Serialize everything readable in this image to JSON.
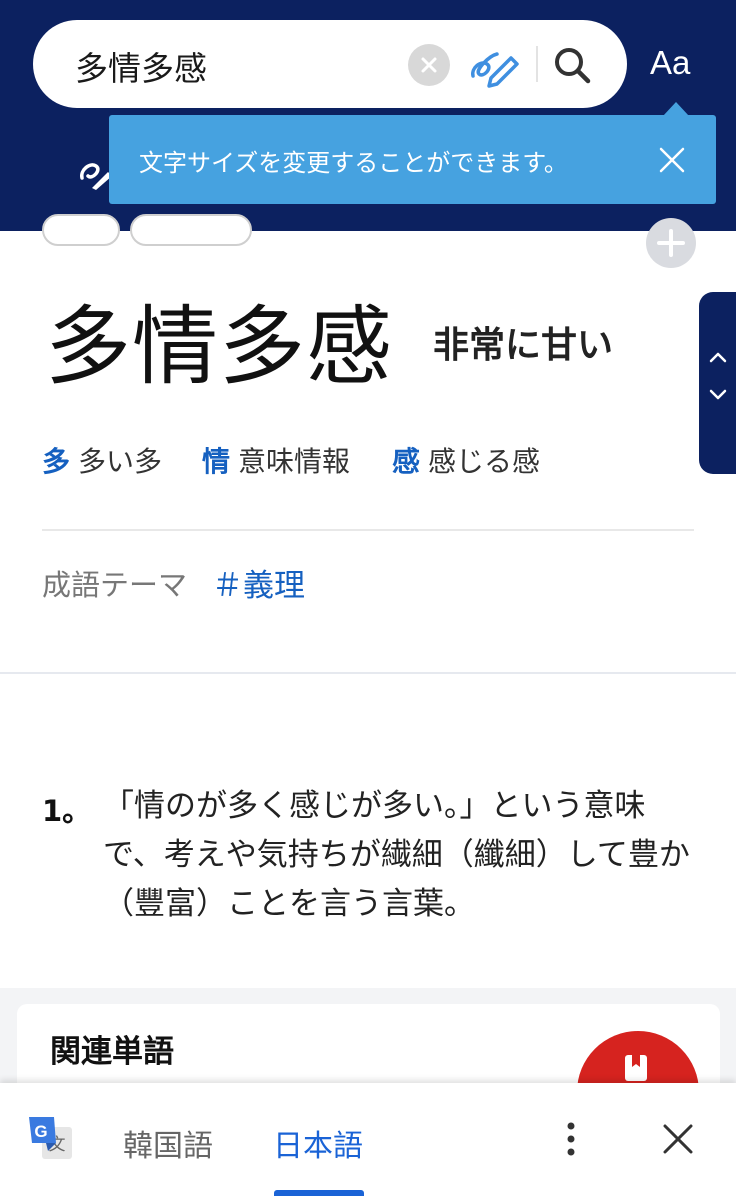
{
  "colors": {
    "header_bg": "#0c2160",
    "tooltip_bg": "#46a2e0",
    "accent_blue": "#1560c0",
    "fab_red": "#d6231f",
    "tab_active": "#1a63d6"
  },
  "header": {
    "search_value": "多情多感",
    "font_size_button": "Aa",
    "icons": [
      "clear-icon",
      "handwriting-icon",
      "search-icon"
    ]
  },
  "tooltip": {
    "text": "文字サイズを変更することができます。",
    "close_icon": "close-icon"
  },
  "entry": {
    "word": "多情多感",
    "meaning_level": "非常に甘い",
    "hanja": [
      {
        "char": "多",
        "gloss": "多い多"
      },
      {
        "char": "情",
        "gloss": "意味情報"
      },
      {
        "char": "感",
        "gloss": "感じる感"
      }
    ],
    "theme_label": "成語テーマ",
    "theme_tag": "＃義理"
  },
  "definition": {
    "number": "1。",
    "text": "「情のが多く感じが多い。」という意味で、考えや気持ちが繊細（纖細）して豊か（豐富）ことを言う言葉。"
  },
  "related": {
    "title": "関連単語"
  },
  "bottom_bar": {
    "languages": [
      "韓国語",
      "日本語"
    ],
    "active_language": "日本語",
    "icons": [
      "google-translate-icon",
      "more-vert-icon",
      "close-icon"
    ]
  }
}
